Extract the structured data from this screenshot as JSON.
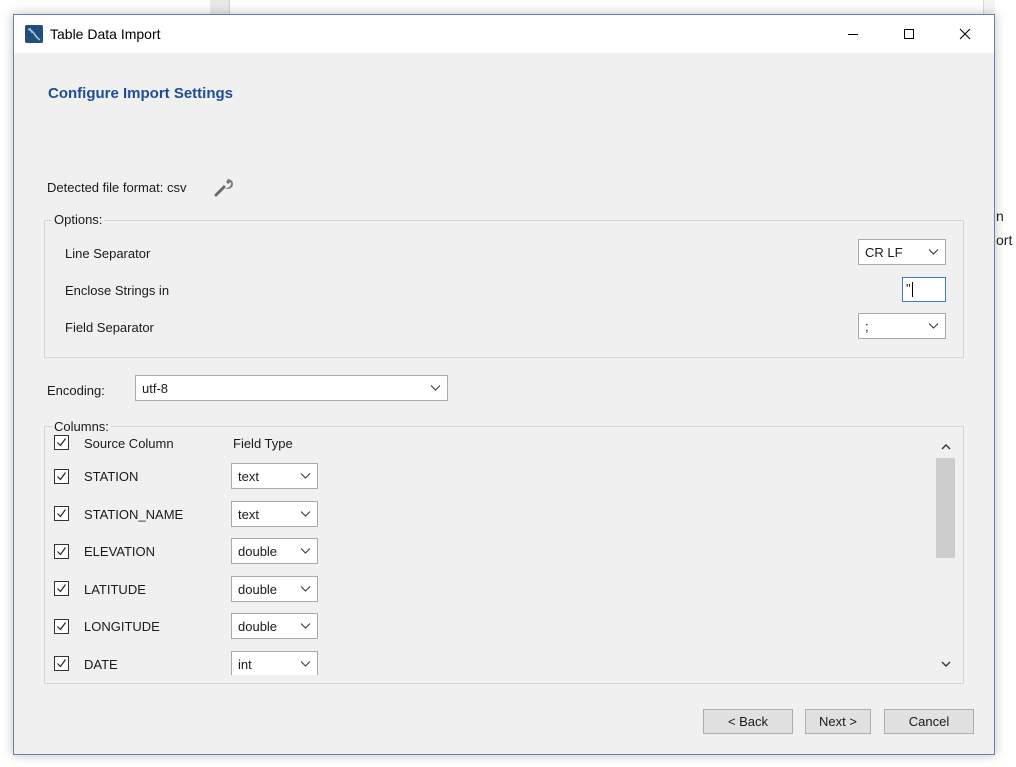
{
  "window": {
    "title": "Table Data Import",
    "minimize_icon": "minimize-icon",
    "maximize_icon": "maximize-icon",
    "close_icon": "close-icon"
  },
  "background_text": {
    "line1": "n",
    "line2": "ort"
  },
  "page": {
    "heading": "Configure Import Settings"
  },
  "detected": {
    "label": "Detected file format: csv",
    "icon": "wrench-icon"
  },
  "options": {
    "group_label": "Options:",
    "line_separator": {
      "label": "Line Separator",
      "value": "CR LF"
    },
    "enclose_strings": {
      "label": "Enclose Strings in",
      "value": "\""
    },
    "field_separator": {
      "label": "Field Separator",
      "value": ";"
    }
  },
  "encoding": {
    "label": "Encoding:",
    "value": "utf-8"
  },
  "columns": {
    "group_label": "Columns:",
    "header_source": "Source Column",
    "header_type": "Field Type",
    "rows": [
      {
        "name": "STATION",
        "type": "text",
        "checked": true
      },
      {
        "name": "STATION_NAME",
        "type": "text",
        "checked": true
      },
      {
        "name": "ELEVATION",
        "type": "double",
        "checked": true
      },
      {
        "name": "LATITUDE",
        "type": "double",
        "checked": true
      },
      {
        "name": "LONGITUDE",
        "type": "double",
        "checked": true
      },
      {
        "name": "DATE",
        "type": "int",
        "checked": true
      }
    ]
  },
  "buttons": {
    "back": "< Back",
    "next": "Next >",
    "cancel": "Cancel"
  },
  "colors": {
    "heading": "#1d4d96",
    "focus_border": "#3c7fc1",
    "window_border": "#5b84b5"
  }
}
